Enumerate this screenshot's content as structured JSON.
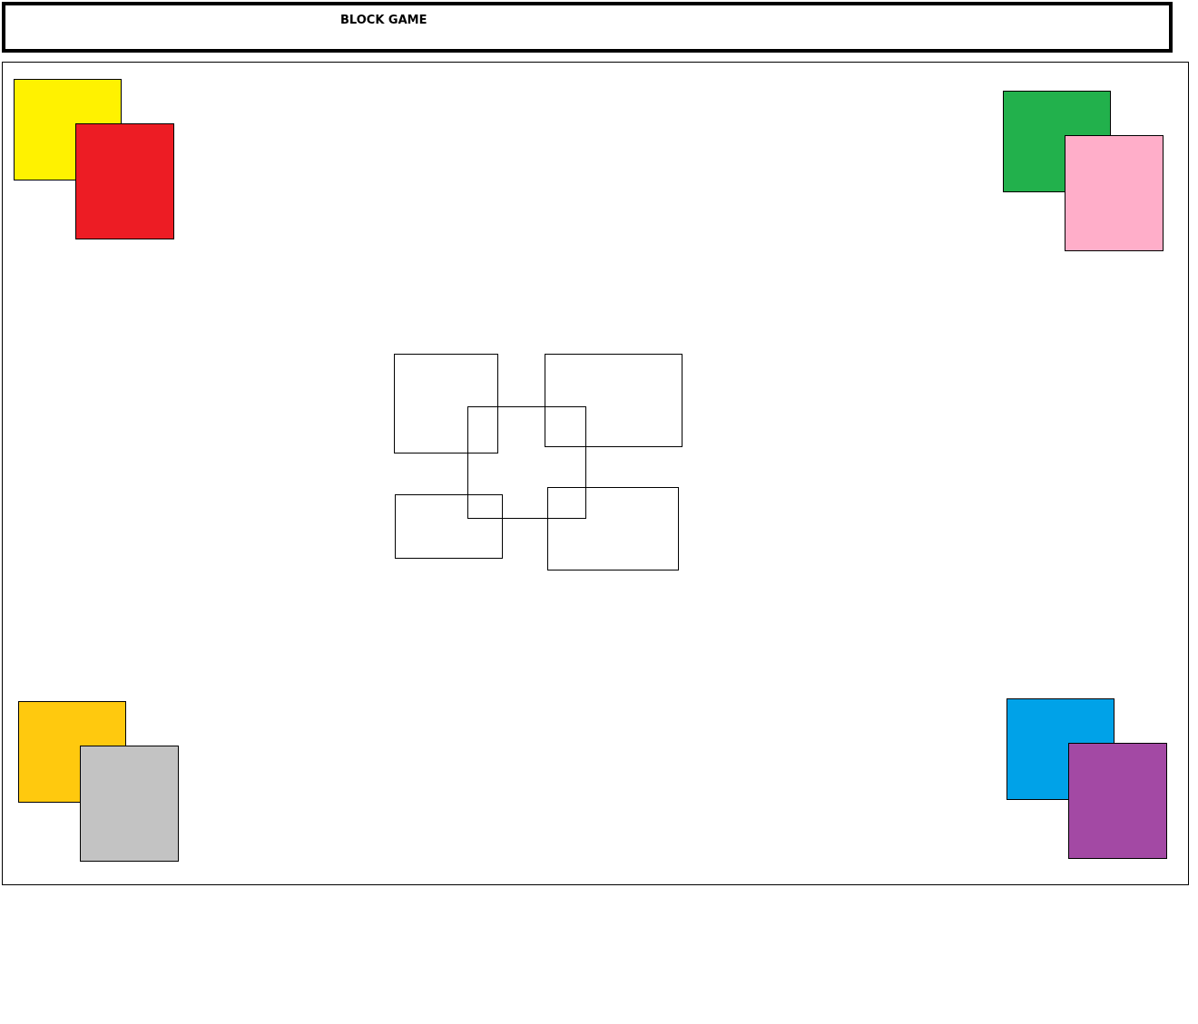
{
  "header": {
    "title": "BLOCK GAME"
  },
  "colors": {
    "yellow": "#FFF200",
    "red": "#ED1C24",
    "green": "#22B14C",
    "pink": "#FFAEC9",
    "orange": "#FFC90E",
    "gray": "#C3C3C3",
    "blue": "#00A2E8",
    "purple": "#A349A4"
  },
  "blocks": [
    "yellow",
    "red",
    "green",
    "pink",
    "orange",
    "gray",
    "blue",
    "purple"
  ],
  "target_slots": 5
}
